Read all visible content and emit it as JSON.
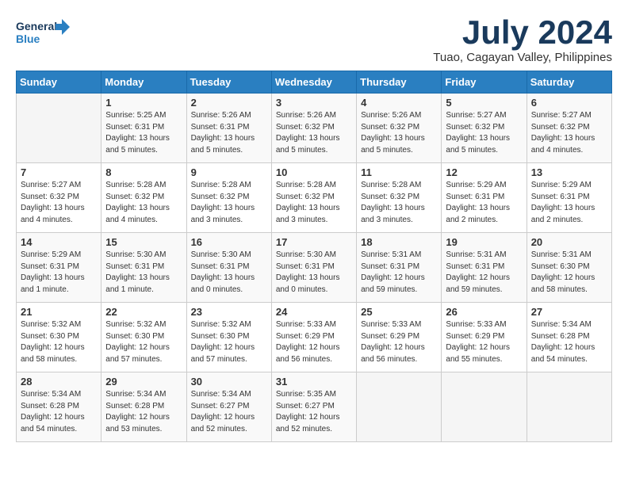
{
  "logo": {
    "line1": "General",
    "line2": "Blue"
  },
  "title": "July 2024",
  "subtitle": "Tuao, Cagayan Valley, Philippines",
  "days_header": [
    "Sunday",
    "Monday",
    "Tuesday",
    "Wednesday",
    "Thursday",
    "Friday",
    "Saturday"
  ],
  "weeks": [
    [
      {
        "day": "",
        "content": ""
      },
      {
        "day": "1",
        "content": "Sunrise: 5:25 AM\nSunset: 6:31 PM\nDaylight: 13 hours\nand 5 minutes."
      },
      {
        "day": "2",
        "content": "Sunrise: 5:26 AM\nSunset: 6:31 PM\nDaylight: 13 hours\nand 5 minutes."
      },
      {
        "day": "3",
        "content": "Sunrise: 5:26 AM\nSunset: 6:32 PM\nDaylight: 13 hours\nand 5 minutes."
      },
      {
        "day": "4",
        "content": "Sunrise: 5:26 AM\nSunset: 6:32 PM\nDaylight: 13 hours\nand 5 minutes."
      },
      {
        "day": "5",
        "content": "Sunrise: 5:27 AM\nSunset: 6:32 PM\nDaylight: 13 hours\nand 5 minutes."
      },
      {
        "day": "6",
        "content": "Sunrise: 5:27 AM\nSunset: 6:32 PM\nDaylight: 13 hours\nand 4 minutes."
      }
    ],
    [
      {
        "day": "7",
        "content": "Sunrise: 5:27 AM\nSunset: 6:32 PM\nDaylight: 13 hours\nand 4 minutes."
      },
      {
        "day": "8",
        "content": "Sunrise: 5:28 AM\nSunset: 6:32 PM\nDaylight: 13 hours\nand 4 minutes."
      },
      {
        "day": "9",
        "content": "Sunrise: 5:28 AM\nSunset: 6:32 PM\nDaylight: 13 hours\nand 3 minutes."
      },
      {
        "day": "10",
        "content": "Sunrise: 5:28 AM\nSunset: 6:32 PM\nDaylight: 13 hours\nand 3 minutes."
      },
      {
        "day": "11",
        "content": "Sunrise: 5:28 AM\nSunset: 6:32 PM\nDaylight: 13 hours\nand 3 minutes."
      },
      {
        "day": "12",
        "content": "Sunrise: 5:29 AM\nSunset: 6:31 PM\nDaylight: 13 hours\nand 2 minutes."
      },
      {
        "day": "13",
        "content": "Sunrise: 5:29 AM\nSunset: 6:31 PM\nDaylight: 13 hours\nand 2 minutes."
      }
    ],
    [
      {
        "day": "14",
        "content": "Sunrise: 5:29 AM\nSunset: 6:31 PM\nDaylight: 13 hours\nand 1 minute."
      },
      {
        "day": "15",
        "content": "Sunrise: 5:30 AM\nSunset: 6:31 PM\nDaylight: 13 hours\nand 1 minute."
      },
      {
        "day": "16",
        "content": "Sunrise: 5:30 AM\nSunset: 6:31 PM\nDaylight: 13 hours\nand 0 minutes."
      },
      {
        "day": "17",
        "content": "Sunrise: 5:30 AM\nSunset: 6:31 PM\nDaylight: 13 hours\nand 0 minutes."
      },
      {
        "day": "18",
        "content": "Sunrise: 5:31 AM\nSunset: 6:31 PM\nDaylight: 12 hours\nand 59 minutes."
      },
      {
        "day": "19",
        "content": "Sunrise: 5:31 AM\nSunset: 6:31 PM\nDaylight: 12 hours\nand 59 minutes."
      },
      {
        "day": "20",
        "content": "Sunrise: 5:31 AM\nSunset: 6:30 PM\nDaylight: 12 hours\nand 58 minutes."
      }
    ],
    [
      {
        "day": "21",
        "content": "Sunrise: 5:32 AM\nSunset: 6:30 PM\nDaylight: 12 hours\nand 58 minutes."
      },
      {
        "day": "22",
        "content": "Sunrise: 5:32 AM\nSunset: 6:30 PM\nDaylight: 12 hours\nand 57 minutes."
      },
      {
        "day": "23",
        "content": "Sunrise: 5:32 AM\nSunset: 6:30 PM\nDaylight: 12 hours\nand 57 minutes."
      },
      {
        "day": "24",
        "content": "Sunrise: 5:33 AM\nSunset: 6:29 PM\nDaylight: 12 hours\nand 56 minutes."
      },
      {
        "day": "25",
        "content": "Sunrise: 5:33 AM\nSunset: 6:29 PM\nDaylight: 12 hours\nand 56 minutes."
      },
      {
        "day": "26",
        "content": "Sunrise: 5:33 AM\nSunset: 6:29 PM\nDaylight: 12 hours\nand 55 minutes."
      },
      {
        "day": "27",
        "content": "Sunrise: 5:34 AM\nSunset: 6:28 PM\nDaylight: 12 hours\nand 54 minutes."
      }
    ],
    [
      {
        "day": "28",
        "content": "Sunrise: 5:34 AM\nSunset: 6:28 PM\nDaylight: 12 hours\nand 54 minutes."
      },
      {
        "day": "29",
        "content": "Sunrise: 5:34 AM\nSunset: 6:28 PM\nDaylight: 12 hours\nand 53 minutes."
      },
      {
        "day": "30",
        "content": "Sunrise: 5:34 AM\nSunset: 6:27 PM\nDaylight: 12 hours\nand 52 minutes."
      },
      {
        "day": "31",
        "content": "Sunrise: 5:35 AM\nSunset: 6:27 PM\nDaylight: 12 hours\nand 52 minutes."
      },
      {
        "day": "",
        "content": ""
      },
      {
        "day": "",
        "content": ""
      },
      {
        "day": "",
        "content": ""
      }
    ]
  ]
}
